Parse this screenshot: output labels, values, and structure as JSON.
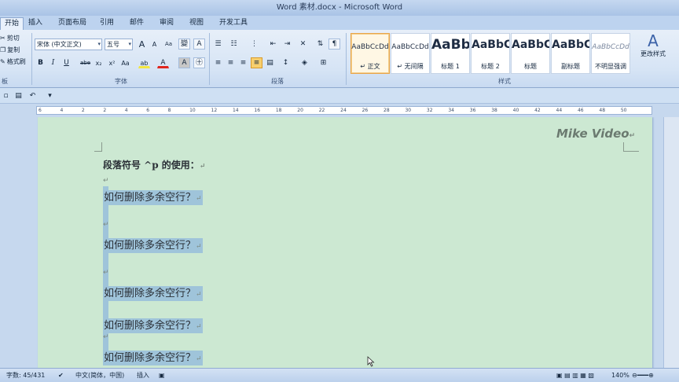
{
  "window": {
    "title": "Word 素材.docx - Microsoft Word"
  },
  "tabs": [
    {
      "label": "开始",
      "active": true
    },
    {
      "label": "插入"
    },
    {
      "label": "页面布局"
    },
    {
      "label": "引用"
    },
    {
      "label": "邮件"
    },
    {
      "label": "审阅"
    },
    {
      "label": "视图"
    },
    {
      "label": "开发工具"
    }
  ],
  "clipboard": {
    "cut": "剪切",
    "copy": "复制",
    "format_painter": "格式刷",
    "group_label": "板"
  },
  "font_group": {
    "font_name": "宋体 (中文正文)",
    "font_size": "五号",
    "group_label": "字体",
    "bold": "B",
    "italic": "I",
    "underline": "U",
    "strike": "abe",
    "sub": "x₂",
    "sup": "x²",
    "clear": "Aa",
    "grow": "A",
    "shrink": "A",
    "highlight": "ab",
    "font_color": "A",
    "char_border": "A",
    "char_shading": "A"
  },
  "paragraph_group": {
    "group_label": "段落"
  },
  "styles_group": {
    "group_label": "样式",
    "items": [
      {
        "preview": "AaBbCcDd",
        "name": "↵ 正文",
        "selected": true
      },
      {
        "preview": "AaBbCcDd",
        "name": "↵ 无间隔"
      },
      {
        "preview": "AaBb",
        "name": "标题 1"
      },
      {
        "preview": "AaBbC",
        "name": "标题 2"
      },
      {
        "preview": "AaBbC",
        "name": "标题"
      },
      {
        "preview": "AaBbC",
        "name": "副标题"
      },
      {
        "preview": "AaBbCcDd",
        "name": "不明显强调"
      }
    ],
    "change_styles": "更改样式"
  },
  "ruler": {
    "numbers": [
      "6",
      "4",
      "2",
      "2",
      "4",
      "6",
      "8",
      "10",
      "12",
      "14",
      "16",
      "18",
      "20",
      "22",
      "24",
      "26",
      "28",
      "30",
      "32",
      "34",
      "36",
      "38",
      "40",
      "42",
      "44",
      "46",
      "48",
      "50"
    ]
  },
  "document": {
    "watermark": "Mike Video",
    "heading": "段落符号 ^p 的使用：",
    "paragraph_mark": "↵",
    "line_text": "如何删除多余空行？"
  },
  "statusbar": {
    "word_count": "字数: 45/431",
    "language": "中文(简体，中国)",
    "mode": "插入",
    "zoom": "140%"
  },
  "colors": {
    "page_bg": "#cce8d2",
    "selection": "#9fc4da",
    "ribbon": "#dce8f6"
  }
}
